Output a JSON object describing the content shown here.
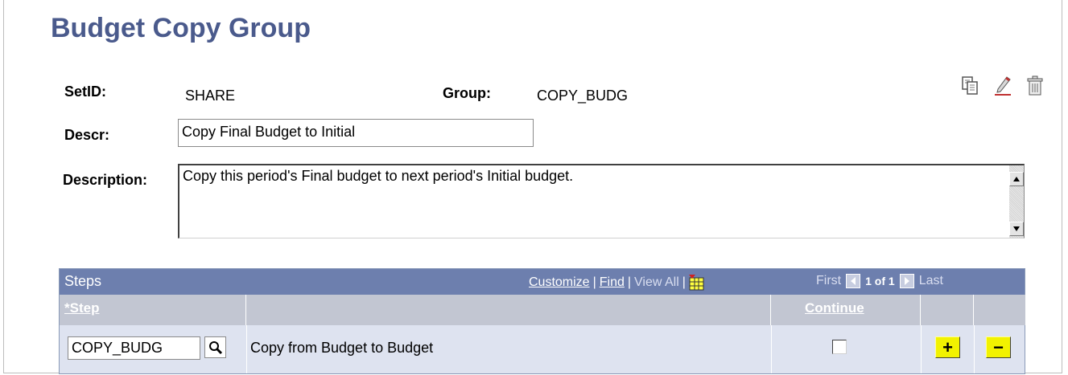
{
  "page": {
    "title": "Budget Copy Group"
  },
  "fields": {
    "setid_label": "SetID:",
    "setid_value": "SHARE",
    "group_label": "Group:",
    "group_value": "COPY_BUDG",
    "descr_label": "Descr:",
    "descr_value": "Copy Final Budget to Initial",
    "description_label": "Description:",
    "description_value": "Copy this period's Final budget to next period's Initial budget."
  },
  "toolbar": {
    "icons": [
      "copy-icon",
      "edit-icon",
      "delete-icon"
    ]
  },
  "grid": {
    "title": "Steps",
    "customize": "Customize",
    "sep1": "|",
    "find": "Find",
    "sep2": "|",
    "view_all": "View All",
    "sep3": "|",
    "first": "First",
    "count": "1 of 1",
    "last": "Last",
    "columns": {
      "step": "*Step",
      "continue": "Continue"
    },
    "rows": [
      {
        "step": "COPY_BUDG",
        "description": "Copy from Budget to Budget",
        "continue": false
      }
    ],
    "add_label": "+",
    "remove_label": "−"
  },
  "colors": {
    "title": "#4a5a8c",
    "grid_header": "#6d7fae",
    "column_header": "#c2c6d2",
    "row": "#dee3f0",
    "button": "#f2f200"
  }
}
